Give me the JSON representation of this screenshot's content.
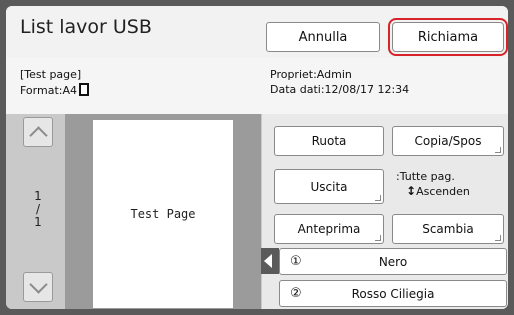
{
  "header": {
    "title": "List lavor USB",
    "cancel_label": "Annulla",
    "recall_label": "Richiama"
  },
  "info": {
    "doc_name": "[Test page]",
    "format": "Format:A4",
    "owner": "Propriet:Admin",
    "date": "Data dati:12/08/17  12:34"
  },
  "preview": {
    "page_text": "Test Page",
    "current_page": "1",
    "separator": "/",
    "total_pages": "1"
  },
  "actions": {
    "rotate_label": "Ruota",
    "copy_label": "Copia/Spos",
    "output_label": "Uscita",
    "sort_line1": ":Tutte pag.",
    "sort_arrow": "↕",
    "sort_line2": "Ascenden",
    "preview_label": "Anteprima",
    "swap_label": "Scambia"
  },
  "colors": [
    {
      "num": "①",
      "name": "Nero"
    },
    {
      "num": "②",
      "name": "Rosso Ciliegia"
    }
  ]
}
